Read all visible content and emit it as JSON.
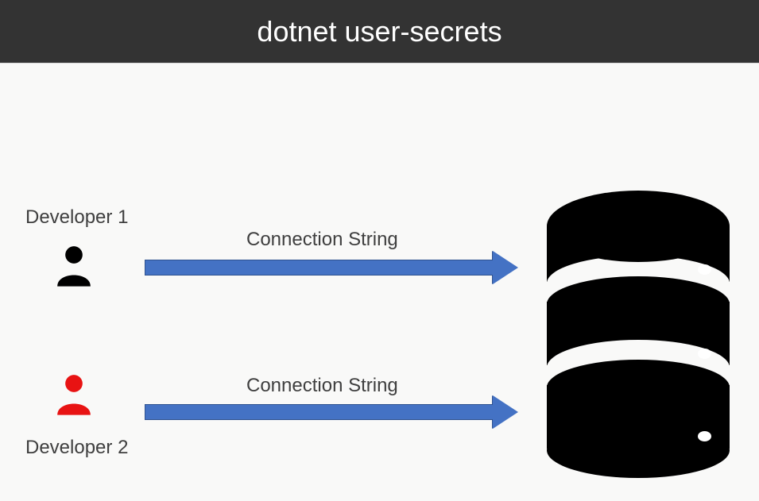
{
  "header": {
    "title": "dotnet user-secrets"
  },
  "developers": [
    {
      "label": "Developer 1",
      "icon_color": "#000000"
    },
    {
      "label": "Developer 2",
      "icon_color": "#e81313"
    }
  ],
  "arrows": [
    {
      "label": "Connection String",
      "color": "#4472c4"
    },
    {
      "label": "Connection String",
      "color": "#4472c4"
    }
  ],
  "database": {
    "name": "database"
  }
}
